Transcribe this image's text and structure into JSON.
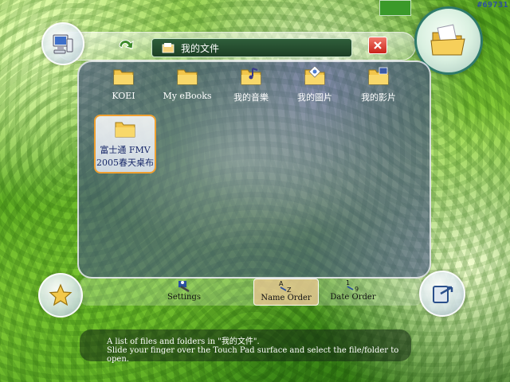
{
  "watermark": "#69731",
  "window": {
    "title": "我的文件"
  },
  "folders": [
    {
      "label": "KOEI",
      "icon": "folder-icon"
    },
    {
      "label": "My eBooks",
      "icon": "folder-icon"
    },
    {
      "label": "我的音樂",
      "icon": "music-folder-icon"
    },
    {
      "label": "我的圖片",
      "icon": "pictures-folder-icon"
    },
    {
      "label": "我的影片",
      "icon": "video-folder-icon"
    },
    {
      "label_line1": "富士通 FMV",
      "label_line2": "2005春天桌布",
      "icon": "folder-icon",
      "selected": true
    }
  ],
  "toolbar": {
    "settings": "Settings",
    "name_order": "Name Order",
    "date_order": "Date Order"
  },
  "hint": {
    "line1": "A list of files and folders in \"我的文件\".",
    "line2": "Slide your finger over the Touch Pad surface and select the file/folder to open."
  },
  "colors": {
    "panel": "#4a5898",
    "title_bar": "#2f5e3a",
    "selected_border": "#f0a030",
    "close": "#c9241a"
  }
}
